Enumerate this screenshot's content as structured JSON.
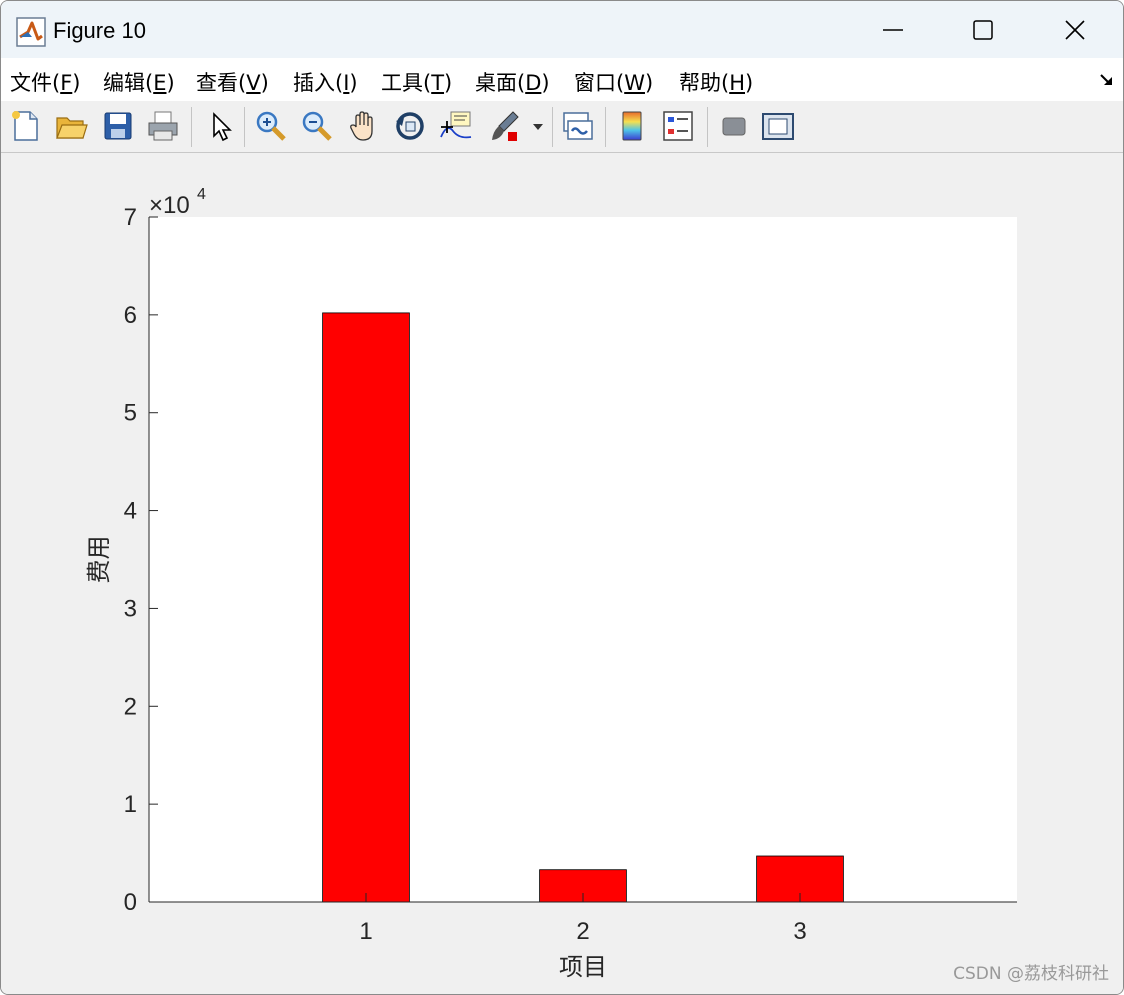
{
  "window": {
    "title": "Figure 10"
  },
  "menu": {
    "items": [
      {
        "label": "文件",
        "key": "F"
      },
      {
        "label": "编辑",
        "key": "E"
      },
      {
        "label": "查看",
        "key": "V"
      },
      {
        "label": "插入",
        "key": "I"
      },
      {
        "label": "工具",
        "key": "T"
      },
      {
        "label": "桌面",
        "key": "D"
      },
      {
        "label": "窗口",
        "key": "W"
      },
      {
        "label": "帮助",
        "key": "H"
      }
    ]
  },
  "toolbar": {
    "icons": [
      "new-figure-icon",
      "open-file-icon",
      "save-icon",
      "print-icon",
      "pointer-icon",
      "zoom-in-icon",
      "zoom-out-icon",
      "pan-hand-icon",
      "rotate-3d-icon",
      "data-cursor-icon",
      "brush-icon",
      "brush-dropdown-icon",
      "link-plot-icon",
      "colorbar-icon",
      "legend-icon",
      "hide-plot-tools-icon",
      "show-plot-tools-icon"
    ]
  },
  "chart_data": {
    "type": "bar",
    "categories": [
      "1",
      "2",
      "3"
    ],
    "values": [
      60200,
      3300,
      4700
    ],
    "bar_color": "#ff0000",
    "xlabel": "项目",
    "ylabel": "费用",
    "ylim": [
      0,
      70000
    ],
    "yticks": [
      "0",
      "1",
      "2",
      "3",
      "4",
      "5",
      "6",
      "7"
    ],
    "ytick_values": [
      0,
      10000,
      20000,
      30000,
      40000,
      50000,
      60000,
      70000
    ],
    "exponent_base": "×10",
    "exponent_power": "4",
    "xlim": [
      0,
      4
    ],
    "grid": false
  },
  "watermark": "CSDN @荔枝科研社"
}
